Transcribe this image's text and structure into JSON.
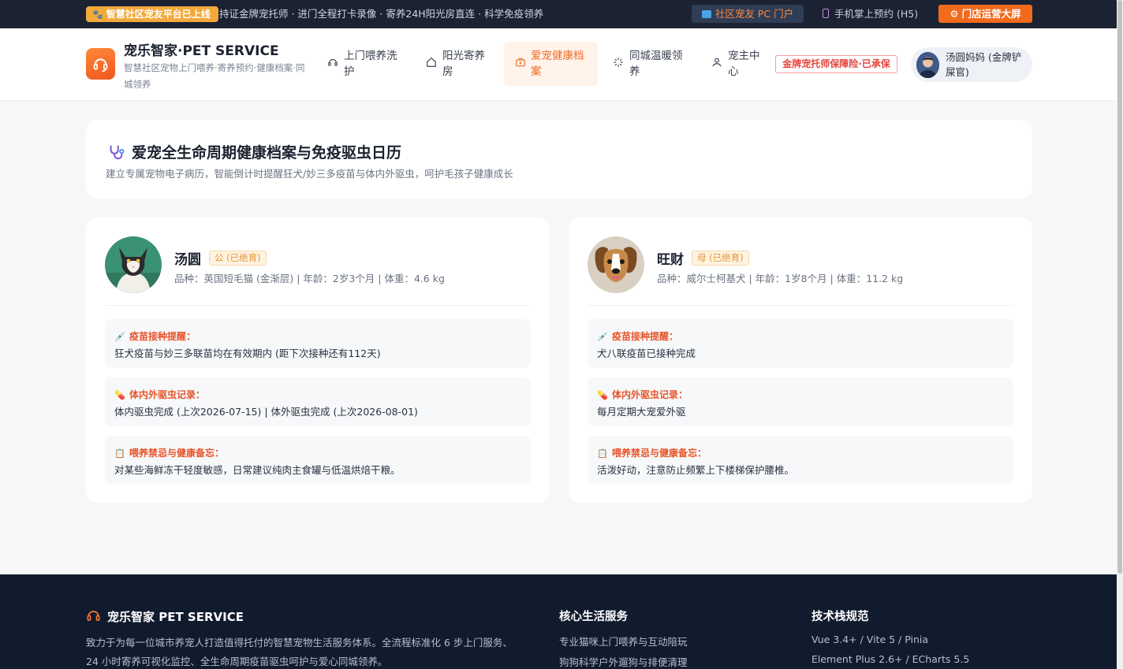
{
  "topbar": {
    "badge": "智慧社区宠友平台已上线",
    "ticker": "持证金牌宠托师 · 进门全程打卡录像 · 寄养24H阳光房直连 · 科学免疫领养",
    "portal_label": "社区宠友 PC 门户",
    "mobile_label": "手机掌上预约 (H5)",
    "screen_label": "门店运营大屏"
  },
  "header": {
    "brand_title": "宠乐智家·PET SERVICE",
    "brand_sub": "智慧社区宠物上门喂养·寄养预约·健康档案·同城领养",
    "nav": [
      {
        "label": "上门喂养洗护",
        "icon": "headset-icon"
      },
      {
        "label": "阳光寄养房",
        "icon": "home-icon"
      },
      {
        "label": "爱宠健康档案",
        "icon": "medical-bag-icon",
        "active": true
      },
      {
        "label": "同城温暖领养",
        "icon": "loader-icon"
      },
      {
        "label": "宠主中心",
        "icon": "user-icon"
      }
    ],
    "insurance_badge": "金牌宠托师保障险·已承保",
    "user_name": "汤圆妈妈 (金牌铲屎官)"
  },
  "hero": {
    "title": "爱宠全生命周期健康档案与免疫驱虫日历",
    "subtitle": "建立专属宠物电子病历，智能倒计时提醒狂犬/妙三多疫苗与体内外驱虫，呵护毛孩子健康成长"
  },
  "pets": [
    {
      "name": "汤圆",
      "tag": "公 (已绝育)",
      "meta": "品种：英国短毛猫 (金渐层) | 年龄：2岁3个月 | 体重：4.6 kg",
      "vaccine_label": "疫苗接种提醒：",
      "vaccine_text": "狂犬疫苗与妙三多联苗均在有效期内 (距下次接种还有112天)",
      "deworm_label": "体内外驱虫记录：",
      "deworm_text": "体内驱虫完成 (上次2026-07-15) | 体外驱虫完成 (上次2026-08-01)",
      "memo_label": "喂养禁忌与健康备忘：",
      "memo_text": "对某些海鲜冻干轻度敏感，日常建议纯肉主食罐与低温烘焙干粮。"
    },
    {
      "name": "旺财",
      "tag": "母 (已绝育)",
      "meta": "品种：威尔士柯基犬 | 年龄：1岁8个月 | 体重：11.2 kg",
      "vaccine_label": "疫苗接种提醒：",
      "vaccine_text": "犬八联疫苗已接种完成",
      "deworm_label": "体内外驱虫记录：",
      "deworm_text": "每月定期大宠爱外驱",
      "memo_label": "喂养禁忌与健康备忘：",
      "memo_text": "活泼好动，注意防止频繁上下楼梯保护腰椎。"
    }
  ],
  "footer": {
    "brand": "宠乐智家 PET SERVICE",
    "desc": "致力于为每一位城市养宠人打造值得托付的智慧宠物生活服务体系。全流程标准化 6 步上门服务、24 小时寄养可视化监控、全生命周期疫苗驱虫呵护与爱心同城领养。",
    "services_title": "核心生活服务",
    "services": [
      "专业猫咪上门喂养与互动陪玩",
      "狗狗科学户外遛狗与排便清理"
    ],
    "tech_title": "技术栈规范",
    "tech": [
      "Vue 3.4+ / Vite 5 / Pinia",
      "Element Plus 2.6+ / ECharts 5.5"
    ]
  },
  "colors": {
    "accent": "#f06a22",
    "topbar_bg": "#1b2333",
    "footer_bg": "#111b2e",
    "danger": "#e7542a"
  }
}
